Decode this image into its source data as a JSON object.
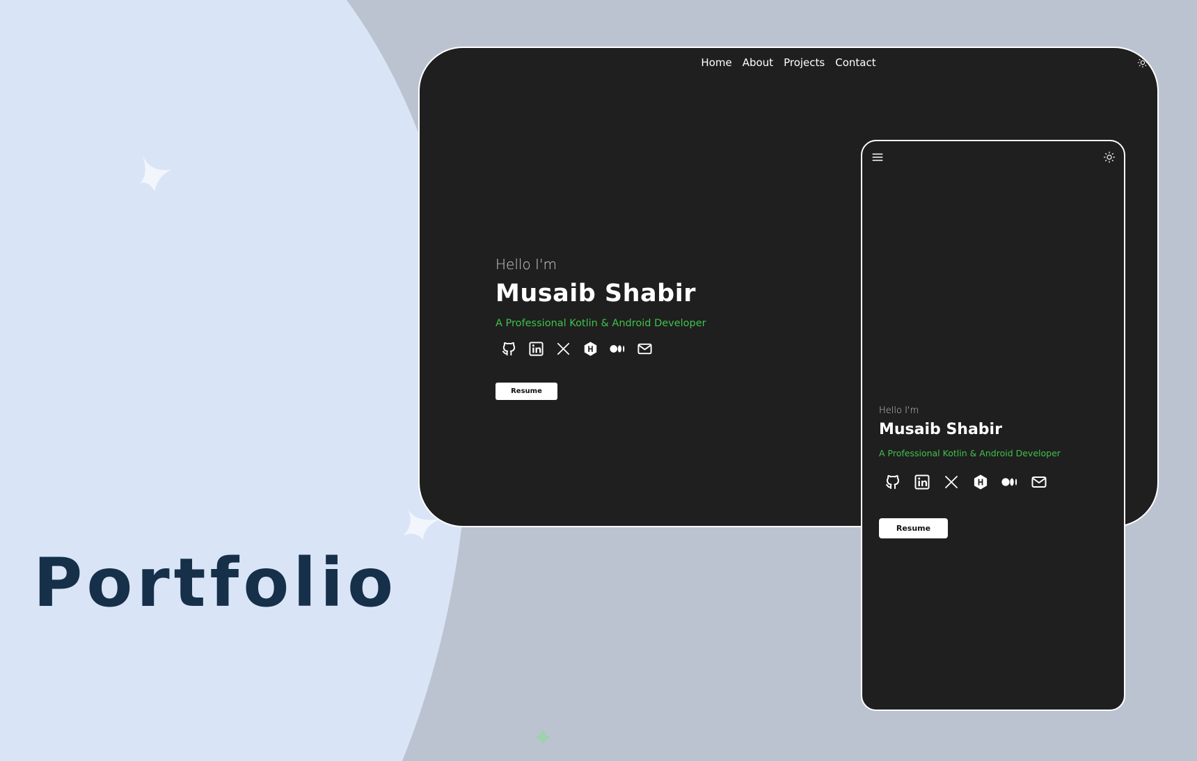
{
  "page": {
    "title": "Portfolio"
  },
  "colors": {
    "background": "#bcc3d0",
    "blob": "#d9e5f6",
    "title": "#16304a",
    "card": "#1f1f1f",
    "accent": "#3fc24a"
  },
  "desktop": {
    "nav": [
      "Home",
      "About",
      "Projects",
      "Contact"
    ],
    "theme_icon": "sun-icon",
    "hero": {
      "greeting": "Hello I'm",
      "name": "Musaib Shabir",
      "tagline": "A Professional Kotlin & Android Developer",
      "resume_label": "Resume"
    }
  },
  "mobile": {
    "menu_icon": "hamburger-icon",
    "theme_icon": "sun-icon",
    "hero": {
      "greeting": "Hello I'm",
      "name": "Musaib Shabir",
      "tagline": "A Professional Kotlin & Android Developer",
      "resume_label": "Resume"
    }
  },
  "socials": [
    "github-icon",
    "linkedin-icon",
    "x-icon",
    "hashnode-icon",
    "medium-icon",
    "mail-icon"
  ]
}
